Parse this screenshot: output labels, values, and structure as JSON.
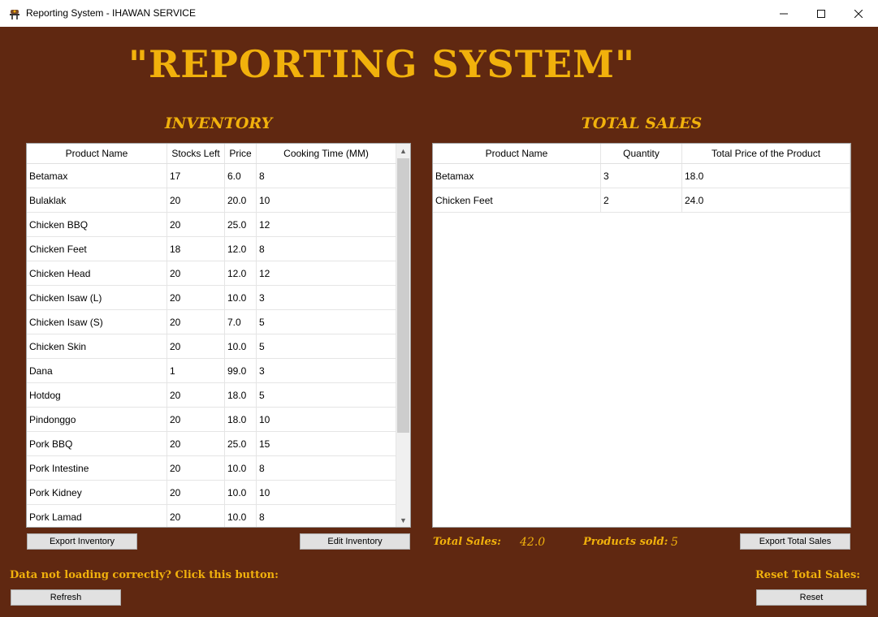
{
  "window": {
    "title": "Reporting System - IHAWAN SERVICE",
    "minimize": "—",
    "maximize": "☐",
    "close": "✕"
  },
  "heading": "\"REPORTING SYSTEM\"",
  "inventory": {
    "title": "INVENTORY",
    "columns": [
      "Product Name",
      "Stocks Left",
      "Price",
      "Cooking Time (MM)"
    ],
    "rows": [
      [
        "Betamax",
        "17",
        "6.0",
        "8"
      ],
      [
        "Bulaklak",
        "20",
        "20.0",
        "10"
      ],
      [
        "Chicken BBQ",
        "20",
        "25.0",
        "12"
      ],
      [
        "Chicken Feet",
        "18",
        "12.0",
        "8"
      ],
      [
        "Chicken Head",
        "20",
        "12.0",
        "12"
      ],
      [
        "Chicken Isaw (L)",
        "20",
        "10.0",
        "3"
      ],
      [
        "Chicken Isaw (S)",
        "20",
        "7.0",
        "5"
      ],
      [
        "Chicken Skin",
        "20",
        "10.0",
        "5"
      ],
      [
        "Dana",
        "1",
        "99.0",
        "3"
      ],
      [
        "Hotdog",
        "20",
        "18.0",
        "5"
      ],
      [
        "Pindonggo",
        "20",
        "18.0",
        "10"
      ],
      [
        "Pork BBQ",
        "20",
        "25.0",
        "15"
      ],
      [
        "Pork Intestine",
        "20",
        "10.0",
        "8"
      ],
      [
        "Pork Kidney",
        "20",
        "10.0",
        "10"
      ],
      [
        "Pork Lamad",
        "20",
        "10.0",
        "8"
      ]
    ],
    "export_label": "Export Inventory",
    "edit_label": "Edit Inventory"
  },
  "sales": {
    "title": "TOTAL SALES",
    "columns": [
      "Product Name",
      "Quantity",
      "Total Price of the Product"
    ],
    "rows": [
      [
        "Betamax",
        "3",
        "18.0"
      ],
      [
        "Chicken Feet",
        "2",
        "24.0"
      ]
    ],
    "total_sales_label": "Total Sales:",
    "total_sales_value": "42.0",
    "products_sold_label": "Products sold:",
    "products_sold_value": "5",
    "export_label": "Export Total Sales"
  },
  "footer": {
    "data_message": "Data not loading correctly? Click this button:",
    "refresh_label": "Refresh",
    "reset_message": "Reset Total Sales:",
    "reset_label": "Reset"
  },
  "colors": {
    "background": "#602811",
    "accent": "#f1b10c"
  }
}
